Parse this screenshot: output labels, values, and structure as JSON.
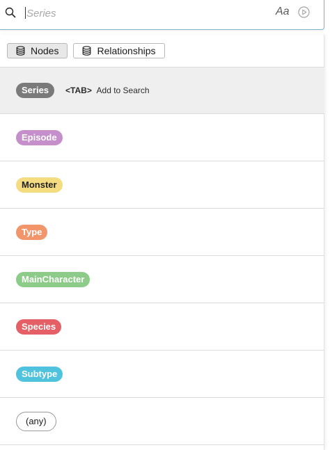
{
  "search": {
    "placeholder": "Series",
    "case_toggle_label": "Aa",
    "search_icon": "search-icon",
    "run_icon": "play-circle-icon"
  },
  "tabs": [
    {
      "label": "Nodes",
      "icon": "database-icon",
      "active": true
    },
    {
      "label": "Relationships",
      "icon": "database-icon",
      "active": false
    }
  ],
  "hint": {
    "key": "<TAB>",
    "text": "Add to Search"
  },
  "labels": [
    {
      "text": "Series",
      "bg": "#7a7a7a",
      "fg": "#ffffff",
      "highlighted": true
    },
    {
      "text": "Episode",
      "bg": "#c58fcb",
      "fg": "#ffffff",
      "highlighted": false
    },
    {
      "text": "Monster",
      "bg": "#f6dc80",
      "fg": "#222222",
      "highlighted": false
    },
    {
      "text": "Type",
      "bg": "#f2956b",
      "fg": "#ffffff",
      "highlighted": false
    },
    {
      "text": "MainCharacter",
      "bg": "#8ccb88",
      "fg": "#ffffff",
      "highlighted": false
    },
    {
      "text": "Species",
      "bg": "#e45f66",
      "fg": "#ffffff",
      "highlighted": false
    },
    {
      "text": "Subtype",
      "bg": "#4fc3dd",
      "fg": "#ffffff",
      "highlighted": false
    },
    {
      "text": "(any)",
      "bg": "#ffffff",
      "fg": "#1a1a1a",
      "highlighted": false,
      "outline": true
    }
  ]
}
